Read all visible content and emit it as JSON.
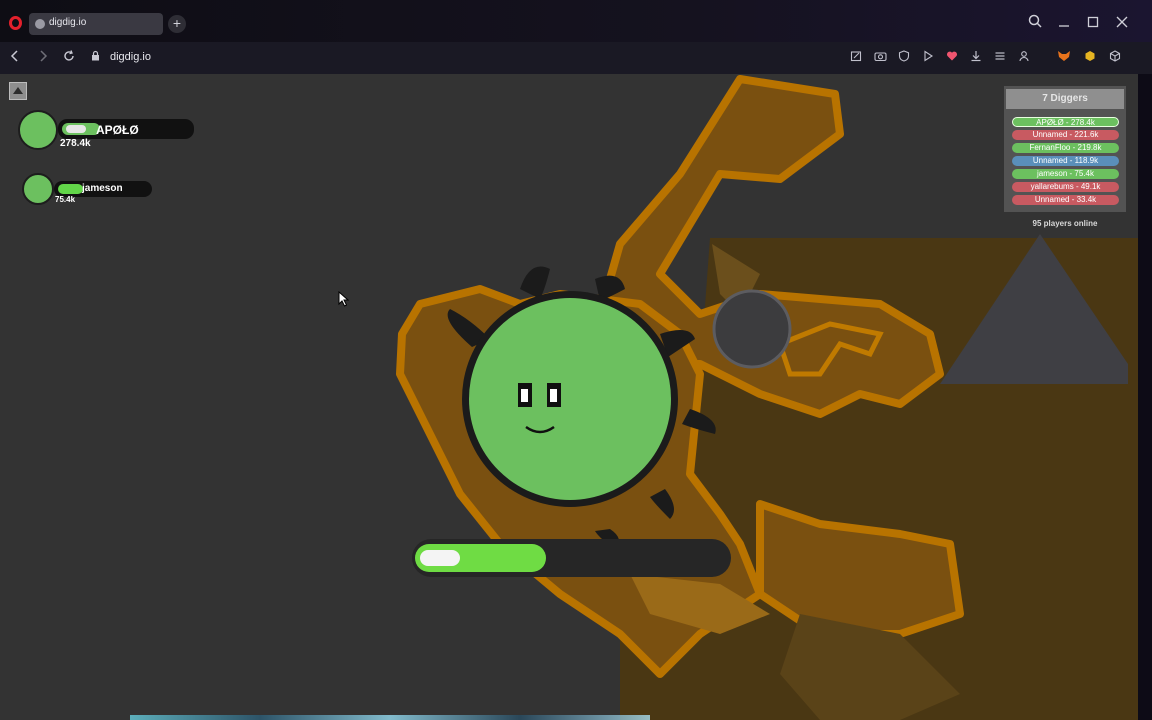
{
  "browser": {
    "tab_title": "digdig.io",
    "url": "digdig.io",
    "new_tab_glyph": "+",
    "icons": [
      "opera-logo-icon",
      "search-icon",
      "minimize-icon",
      "maximize-icon",
      "close-icon",
      "back-icon",
      "forward-icon",
      "reload-icon",
      "lock-icon",
      "snapshot-icon",
      "camera-icon",
      "vpn-icon",
      "play-icon",
      "heart-icon",
      "download-icon",
      "easy-setup-icon",
      "profile-icon",
      "extension-fox-icon",
      "extension-hex-icon",
      "extension-box-icon"
    ]
  },
  "team": [
    {
      "name": "APØŁØ",
      "score": "278.4k",
      "health_fraction": 0.28
    },
    {
      "name": "jameson",
      "score": "75.4k",
      "health_fraction": 0.25
    }
  ],
  "leaderboard": {
    "title": "7 Diggers",
    "rows": [
      {
        "label": "APØŁØ - 278.4k",
        "color": "#6cc05f",
        "highlight": true
      },
      {
        "label": "Unnamed - 221.6k",
        "color": "#c85a61"
      },
      {
        "label": "FernanFloo - 219.8k",
        "color": "#6cc05f"
      },
      {
        "label": "Unnamed - 118.9k",
        "color": "#5a8fba"
      },
      {
        "label": "jameson - 75.4k",
        "color": "#6cc05f"
      },
      {
        "label": "yallarebums - 49.1k",
        "color": "#c85a61"
      },
      {
        "label": "Unnamed - 33.4k",
        "color": "#c85a61"
      }
    ],
    "players_online": "95 players online"
  },
  "player": {
    "color": "#6cc05f",
    "boost_fraction": 0.42
  },
  "colors": {
    "ground": "#333333",
    "tunnel": "#8a5a10",
    "tunnel_edge": "#b87300",
    "team_green": "#6cc05f",
    "boost": "#6fdc44"
  }
}
